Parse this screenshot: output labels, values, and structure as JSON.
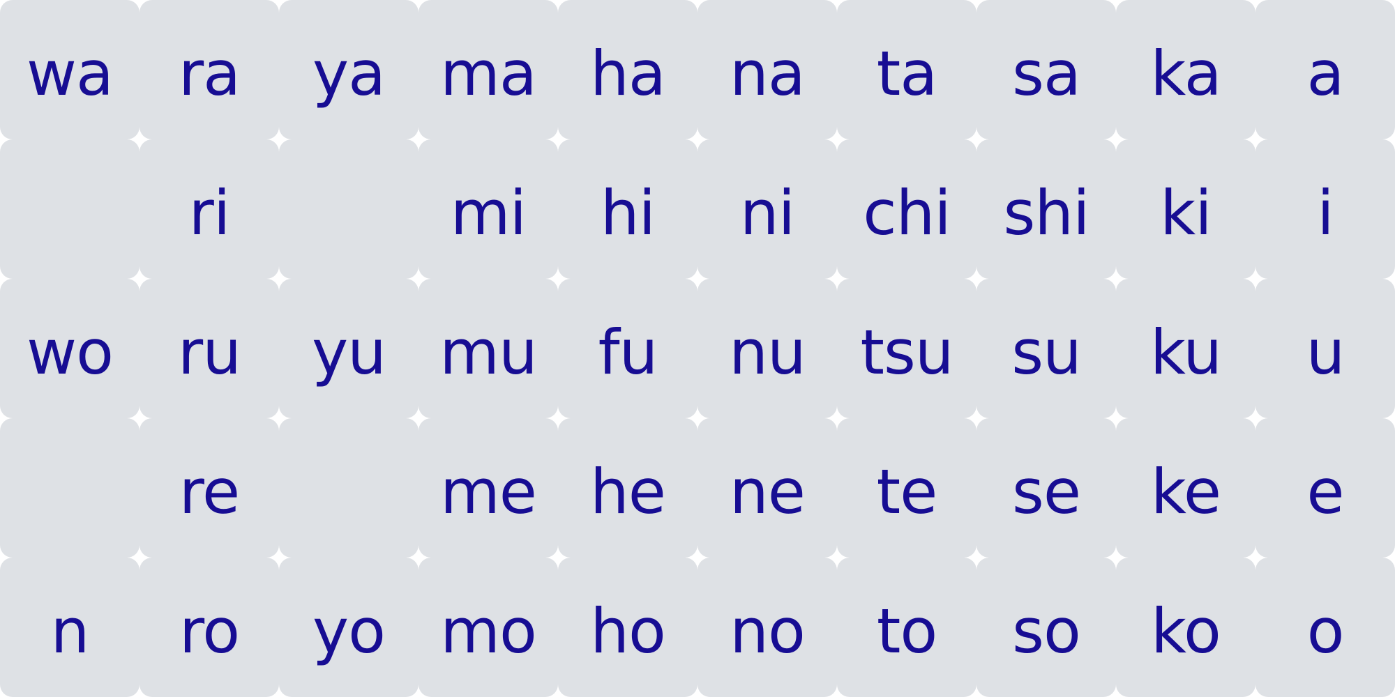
{
  "chart": {
    "rows": [
      [
        "wa",
        "ra",
        "ya",
        "ma",
        "ha",
        "na",
        "ta",
        "sa",
        "ka",
        "a"
      ],
      [
        "",
        "ri",
        "",
        "mi",
        "hi",
        "ni",
        "chi",
        "shi",
        "ki",
        "i"
      ],
      [
        "wo",
        "ru",
        "yu",
        "mu",
        "fu",
        "nu",
        "tsu",
        "su",
        "ku",
        "u"
      ],
      [
        "",
        "re",
        "",
        "me",
        "he",
        "ne",
        "te",
        "se",
        "ke",
        "e"
      ],
      [
        "n",
        "ro",
        "yo",
        "mo",
        "ho",
        "no",
        "to",
        "so",
        "ko",
        "o"
      ]
    ]
  },
  "colors": {
    "cell_background": "#dee1e5",
    "text": "#170d93",
    "page_background": "#ffffff"
  }
}
